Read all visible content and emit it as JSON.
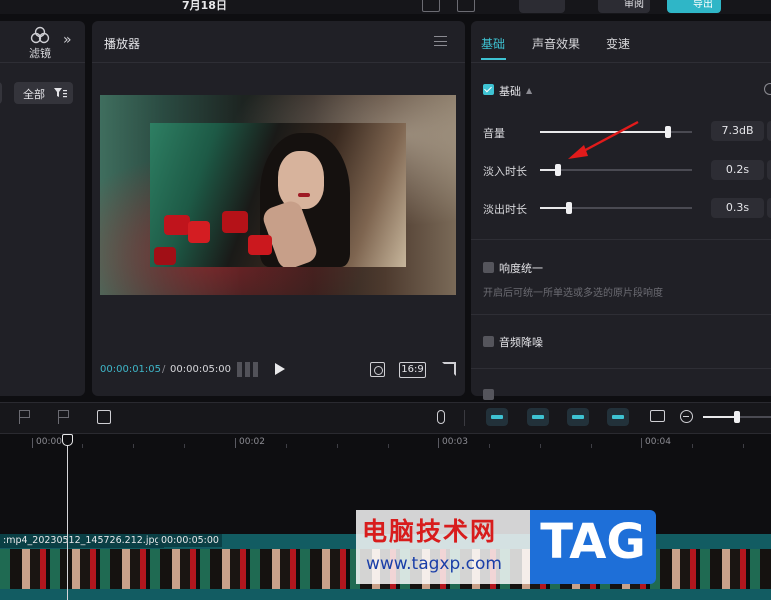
{
  "top_bar": {
    "date": "7月18日",
    "review_label": "审阅",
    "export_label": "导出"
  },
  "left_panel": {
    "filters_label": "滤镜",
    "filter_all_label": "全部"
  },
  "player": {
    "title": "播放器",
    "current_time": "00:00:01:05",
    "total_time": "00:00:05:00",
    "aspect_ratio": "16:9"
  },
  "inspector": {
    "tabs": [
      {
        "label": "基础",
        "active": true
      },
      {
        "label": "声音效果",
        "active": false
      },
      {
        "label": "变速",
        "active": false
      }
    ],
    "basic_section": {
      "label": "基础",
      "checked": true
    },
    "rows": [
      {
        "label": "音量",
        "value": "7.3dB",
        "fraction": 0.84
      },
      {
        "label": "淡入时长",
        "value": "0.2s",
        "fraction": 0.12
      },
      {
        "label": "淡出时长",
        "value": "0.3s",
        "fraction": 0.19
      }
    ],
    "loudness": {
      "label": "响度统一",
      "hint": "开启后可统一所单选或多选的原片段响度",
      "checked": false
    },
    "denoise": {
      "label": "音频降噪",
      "checked": false
    }
  },
  "timeline": {
    "ruler_labels": [
      "00:00",
      "00:02",
      "00:03",
      "00:04"
    ],
    "clip_name": ":mp4_20230512_145726.212.jpg",
    "clip_duration": "00:00:05:00",
    "zoom_fraction": 0.5
  },
  "watermark": {
    "title": "电脑技术网",
    "url": "www.tagxp.com",
    "tag": "TAG"
  },
  "colors": {
    "accent": "#3ec3d3",
    "background": "#0e0e11",
    "panel": "#202026",
    "clip": "#125c62"
  }
}
